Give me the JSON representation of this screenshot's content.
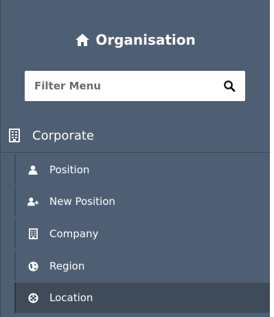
{
  "brand": {
    "title": "Organisation",
    "icon": "home-icon"
  },
  "filter": {
    "placeholder": "Filter Menu",
    "icon": "search-icon"
  },
  "section": {
    "label": "Corporate",
    "icon": "building-icon"
  },
  "items": [
    {
      "label": "Position",
      "icon": "user-icon"
    },
    {
      "label": "New Position",
      "icon": "user-add-icon"
    },
    {
      "label": "Company",
      "icon": "building-icon"
    },
    {
      "label": "Region",
      "icon": "globe-icon"
    },
    {
      "label": "Location",
      "icon": "crosshair-icon",
      "active": true
    }
  ],
  "colors": {
    "sidebar_bg": "#4f5f73",
    "active_bg": "#3f4b59",
    "text": "#ffffff"
  }
}
